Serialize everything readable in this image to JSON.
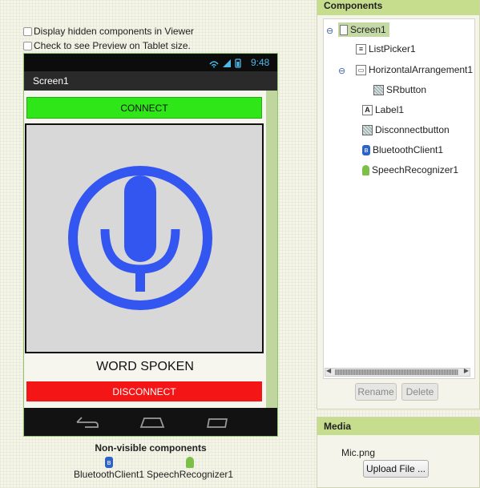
{
  "viewer": {
    "hidden_components_label": "Display hidden components in Viewer",
    "tablet_preview_label": "Check to see Preview on Tablet size."
  },
  "phone": {
    "status_time": "9:48",
    "screen_title": "Screen1",
    "connect_label": "CONNECT",
    "word_spoken_label": "WORD SPOKEN",
    "disconnect_label": "DISCONNECT",
    "colors": {
      "connect": "#2fe619",
      "disconnect": "#f41616",
      "mic": "#3355f0"
    }
  },
  "nonvisible": {
    "title": "Non-visible components",
    "items": [
      {
        "label": "BluetoothClient1",
        "icon": "bluetooth-icon"
      },
      {
        "label": "SpeechRecognizer1",
        "icon": "android-icon"
      }
    ]
  },
  "components": {
    "title": "Components",
    "tree": [
      {
        "label": "Screen1",
        "icon": "screen-icon",
        "toggle": "⊖",
        "selected": true
      },
      {
        "label": "ListPicker1",
        "icon": "listpicker-icon"
      },
      {
        "label": "HorizontalArrangement1",
        "icon": "arrangement-icon",
        "toggle": "⊖"
      },
      {
        "label": "SRbutton",
        "icon": "button-icon"
      },
      {
        "label": "Label1",
        "icon": "label-icon"
      },
      {
        "label": "Disconnectbutton",
        "icon": "button-icon"
      },
      {
        "label": "BluetoothClient1",
        "icon": "bluetooth-icon"
      },
      {
        "label": "SpeechRecognizer1",
        "icon": "android-icon"
      }
    ],
    "rename_label": "Rename",
    "delete_label": "Delete"
  },
  "media": {
    "title": "Media",
    "file": "Mic.png",
    "upload_label": "Upload File ..."
  }
}
